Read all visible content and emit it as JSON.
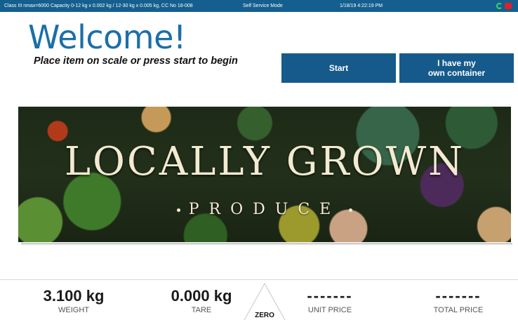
{
  "status_bar": {
    "legal_text": "Class III nmax=6000 Capacity 0-12 kg x 0.002 kg / 12-30 kg x 0.005 kg, CC No 18-008",
    "mode": "Self Service Mode",
    "datetime": "1/18/19 4:22:19 PM",
    "icons": [
      "refresh-icon",
      "alert-icon"
    ],
    "colors": {
      "bar": "#145f8f",
      "refresh": "#3fd26a",
      "alert": "#e0202a"
    }
  },
  "welcome": {
    "title": "Welcome!",
    "subtitle": "Place item on scale or press start to begin"
  },
  "buttons": {
    "start_label": "Start",
    "container_line1": "I have my",
    "container_line2": "own container"
  },
  "banner": {
    "title": "LOCALLY GROWN",
    "subtitle": "PRODUCE"
  },
  "readouts": {
    "weight": {
      "value": "3.100 kg",
      "label": "WEIGHT"
    },
    "tare": {
      "value": "0.000 kg",
      "label": "TARE"
    },
    "zero_label": "ZERO",
    "unit_price": {
      "value": "-------",
      "label": "UNIT PRICE"
    },
    "total_price": {
      "value": "-------",
      "label": "TOTAL PRICE"
    }
  },
  "colors": {
    "accent": "#165a8c",
    "title": "#1a6fa8"
  }
}
